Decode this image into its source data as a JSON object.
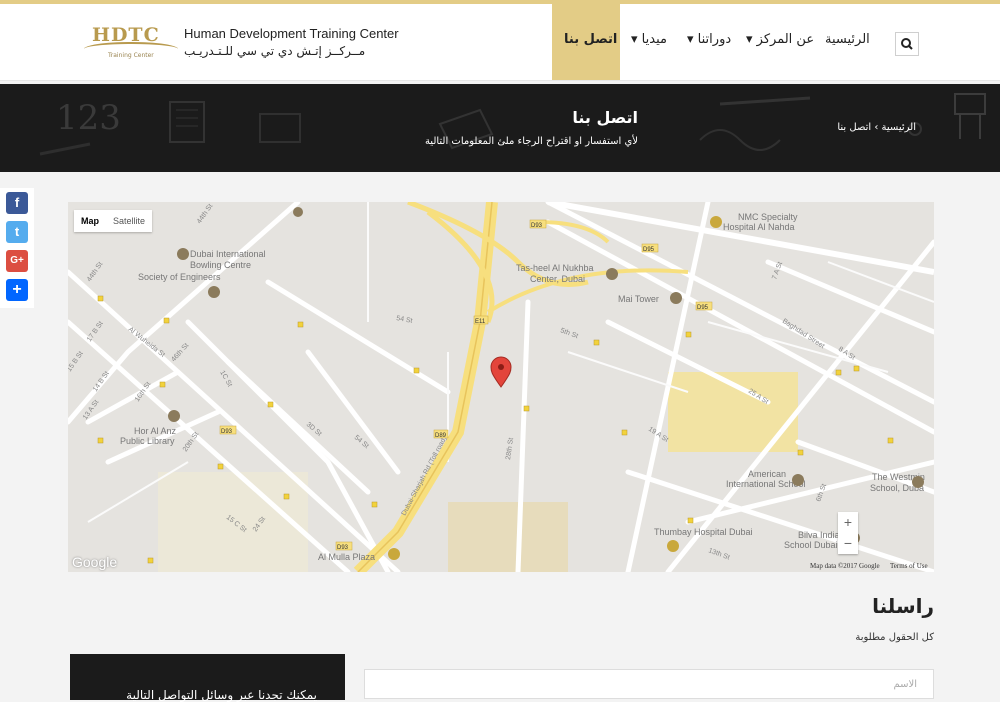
{
  "header": {
    "logo_letters": "HDTC",
    "logo_sub": "Training Center",
    "logo_en": "Human Development Training Center",
    "logo_ar": "مــركــز إتـش دي تي سي للـتـدريـب",
    "nav": [
      {
        "label": "اتصل بنا",
        "active": true
      },
      {
        "label": "▾ ميديا"
      },
      {
        "label": "▾ دوراتنا"
      },
      {
        "label": "▾ عن المركز"
      },
      {
        "label": "الرئيسية"
      }
    ],
    "search_icon": "search-icon"
  },
  "banner": {
    "title": "اتصل بنا",
    "subtitle": "لأي استفسار او اقتراح الرجاء ملئ المعلومات التالية",
    "breadcrumb": "الرئيسية › اتصل بنا",
    "deco_number": "123"
  },
  "share": [
    {
      "icon": "facebook-icon",
      "glyph": "f",
      "color": "#3b5998"
    },
    {
      "icon": "twitter-icon",
      "glyph": "t",
      "color": "#55acee"
    },
    {
      "icon": "google-plus-icon",
      "glyph": "G+",
      "color": "#dc4e41"
    },
    {
      "icon": "share-icon",
      "glyph": "+",
      "color": "#0166ff"
    }
  ],
  "map": {
    "map_label": "Map",
    "satellite_label": "Satellite",
    "zoom_in": "+",
    "zoom_out": "−",
    "google": "Google",
    "map_data": "Map data ©2017 Google",
    "terms": "Terms of Use",
    "labels": [
      "Dubai International",
      "Bowling Centre",
      "Society of Engineers",
      "Tas-heel Al Nukhba",
      "Center, Dubai",
      "Mai Tower",
      "NMC Specialty",
      "Hospital Al Nahda",
      "Hor Al Anz",
      "Public Library",
      "American",
      "International School",
      "The Westmin",
      "School, Duba",
      "Thumbay Hospital Dubai",
      "Bilva Indian",
      "School Dubai",
      "Al Mulla Plaza",
      "Dubai-Sharjah Rd (Toll road)",
      "Al Wuheida St",
      "46th St",
      "44th St",
      "Baghdad Street",
      "28th St",
      "5th St",
      "54 St",
      "3D St",
      "15 C St",
      "24 St",
      "20th St",
      "16th St",
      "14 B St",
      "15 B St",
      "17 B St",
      "13 A St",
      "1C St",
      "25 A St",
      "19 A St",
      "13th St",
      "6th St",
      "7 A St",
      "8 A St",
      "44th St",
      "D93",
      "D95",
      "D89",
      "E11"
    ]
  },
  "contact": {
    "title": "راسلنا",
    "required_note": "كل الحقول مطلوبة",
    "dark_box_text": "يمكنك تجدنا عبر وسائل التواصل التالية",
    "name_placeholder": "الاسم"
  },
  "colors": {
    "accent": "#e3cc86",
    "dark": "#1b1b1b",
    "map_bg": "#e5e3df",
    "highway": "#f7df7e",
    "marker": "#e3453b"
  }
}
